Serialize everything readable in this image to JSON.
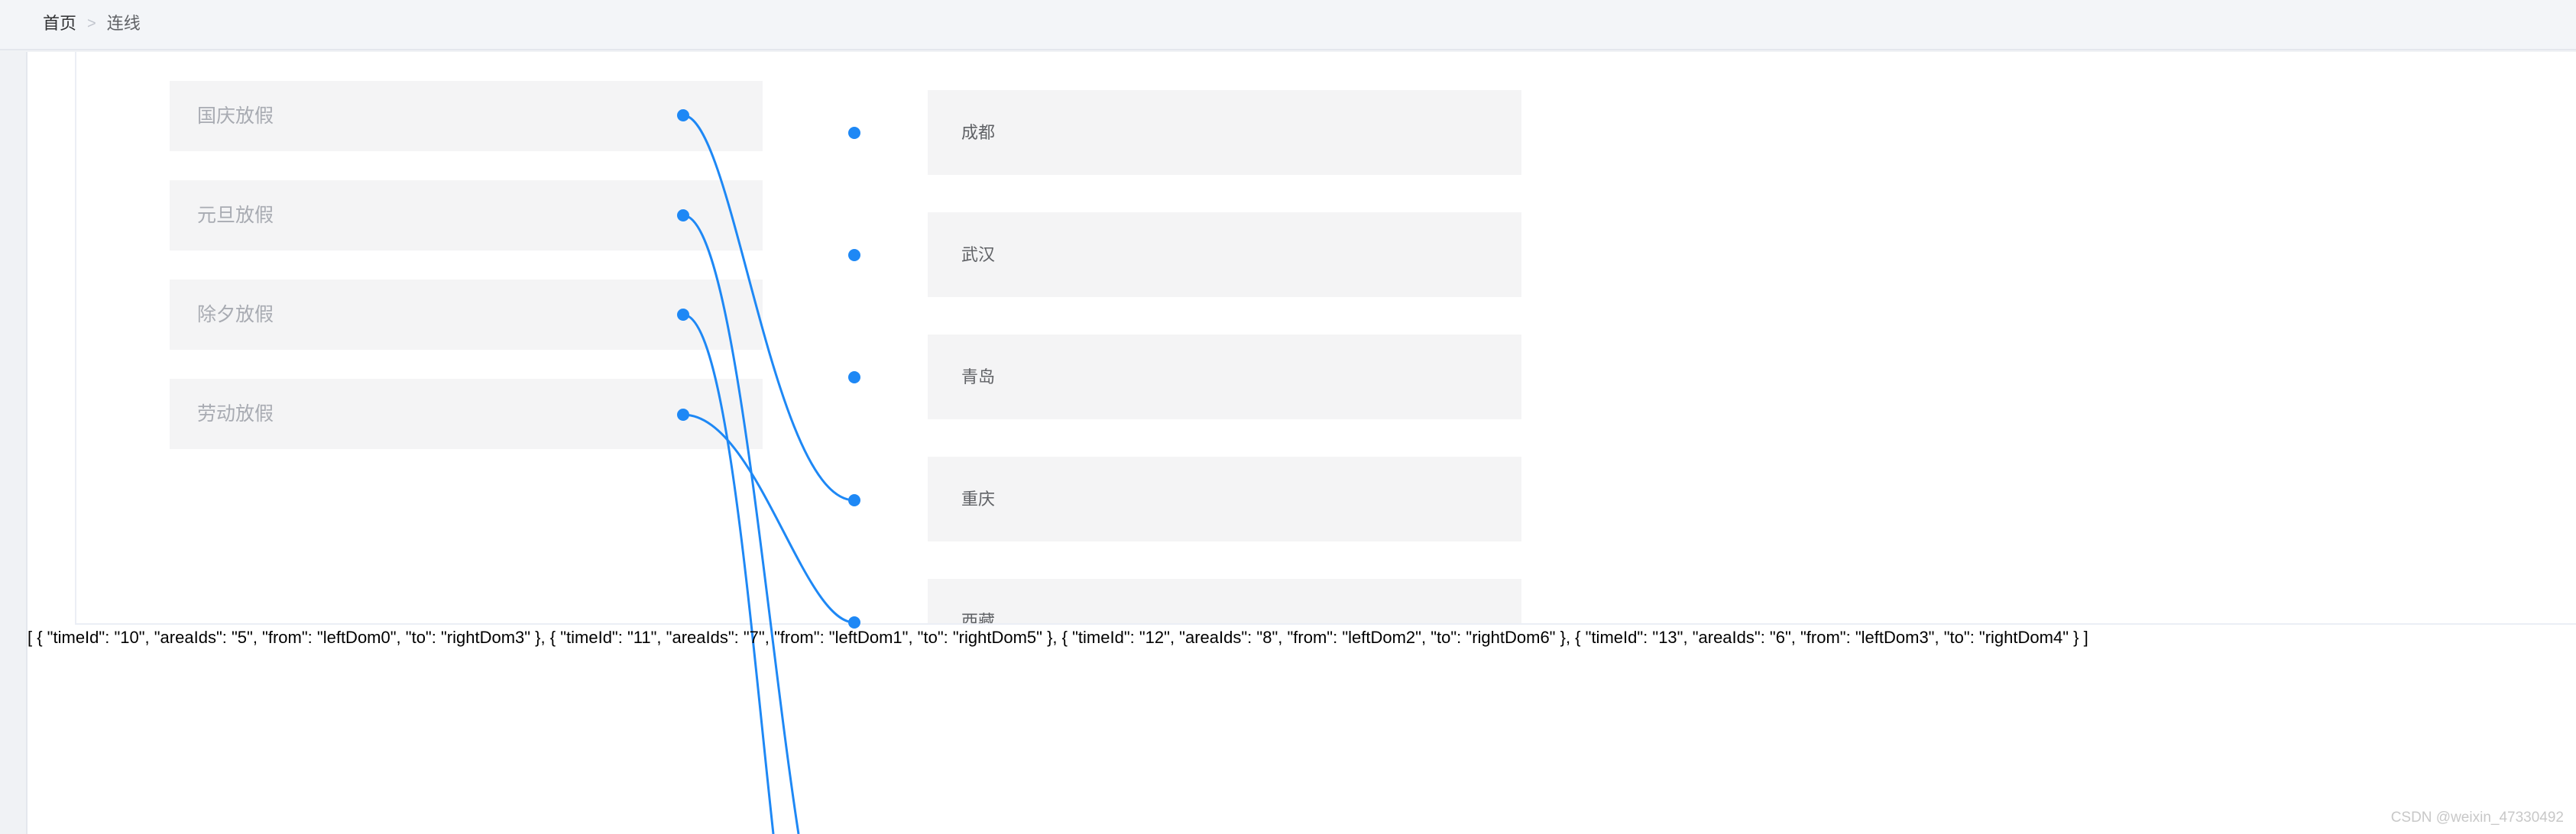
{
  "breadcrumb": {
    "home": "首页",
    "separator": ">",
    "current": "连线"
  },
  "left_items": [
    {
      "label": "国庆放假"
    },
    {
      "label": "元旦放假"
    },
    {
      "label": "除夕放假"
    },
    {
      "label": "劳动放假"
    }
  ],
  "right_items": [
    {
      "label": "成都"
    },
    {
      "label": "武汉"
    },
    {
      "label": "青岛"
    },
    {
      "label": "重庆"
    },
    {
      "label": "西藏"
    }
  ],
  "connections": [
    {
      "from": "leftDom0",
      "to": "rightDom3"
    },
    {
      "from": "leftDom1",
      "to": "rightDom5"
    },
    {
      "from": "leftDom2",
      "to": "rightDom6"
    },
    {
      "from": "leftDom3",
      "to": "rightDom4"
    }
  ],
  "output_text": "[ { \"timeId\": \"10\", \"areaIds\": \"5\", \"from\": \"leftDom0\", \"to\": \"rightDom3\" }, { \"timeId\": \"11\", \"areaIds\": \"7\", \"from\": \"leftDom1\", \"to\": \"rightDom5\" }, { \"timeId\": \"12\", \"areaIds\": \"8\", \"from\": \"leftDom2\", \"to\": \"rightDom6\" }, { \"timeId\": \"13\", \"areaIds\": \"6\", \"from\": \"leftDom3\", \"to\": \"rightDom4\" } ]",
  "watermark": "CSDN @weixin_47330492",
  "colors": {
    "line": "#1e88f5",
    "item_bg": "#f4f4f5"
  }
}
